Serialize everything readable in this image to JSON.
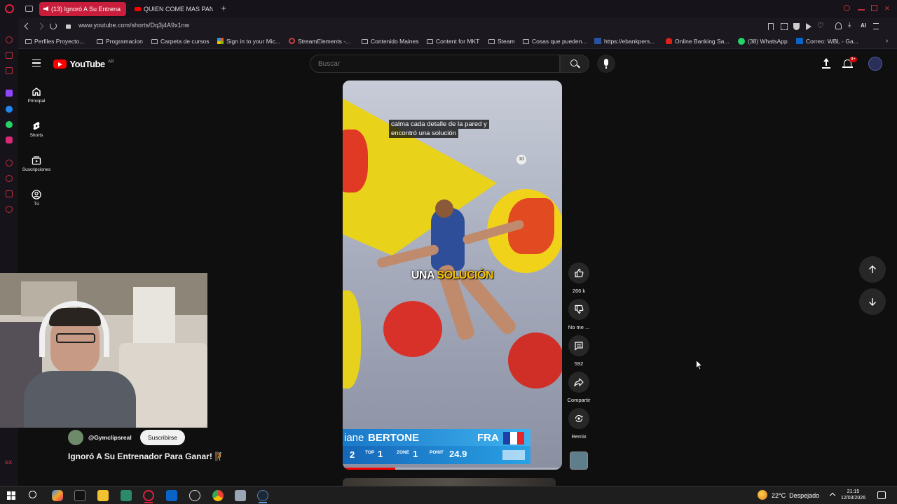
{
  "browser": {
    "tabs": [
      {
        "label": "(13) Ignoró A Su Entrena",
        "active": true
      },
      {
        "label": "QUIEN COME MAS PANCHO",
        "active": false
      }
    ],
    "url": "www.youtube.com/shorts/Dq3j4A9x1nw",
    "ai_label": "AI",
    "bookmarks": [
      "Perfiles Proyecto...",
      "Programacion",
      "Carpeta de cursos",
      "Sign in to your Mic...",
      "StreamElements -...",
      "Contenido Maines",
      "Content for MKT",
      "Steam",
      "Cosas que pueden...",
      "https://ebankpers...",
      "Online Banking Sa...",
      "(38) WhatsApp",
      "Correo: WBL - Ga..."
    ],
    "bookmark_badge": "38"
  },
  "youtube": {
    "logo_text": "YouTube",
    "logo_region": "AR",
    "search": {
      "placeholder": "Buscar"
    },
    "notif_badge": "9+",
    "nav": [
      {
        "label": "Principal",
        "icon": "home-icon"
      },
      {
        "label": "Shorts",
        "icon": "shorts-icon"
      },
      {
        "label": "Suscripciones",
        "icon": "subscriptions-icon"
      },
      {
        "label": "Tú",
        "icon": "you-icon"
      }
    ],
    "video": {
      "subtitle_line1": "calma cada detalle de la pared y",
      "subtitle_line2": "encontró una solución",
      "caption_white": "UNA",
      "caption_yellow": "SOLUCIÓN",
      "hold_number": "10",
      "scoreboard": {
        "name_prefix": "iane",
        "name": "BERTONE",
        "country": "FRA",
        "rank": "2",
        "top_label": "TOP",
        "top_value": "1",
        "zone_label": "ZONE",
        "zone_value": "1",
        "point_label": "POINT",
        "point_value": "24.9"
      },
      "progress": 0.24
    },
    "actions": {
      "like_count": "266 k",
      "dislike_label": "No me ...",
      "comments_count": "592",
      "share_label": "Compartir",
      "remix_label": "Remix"
    },
    "channel": {
      "handle": "@Gymclipsreal",
      "subscribe_label": "Suscribirse",
      "title": "Ignoró A Su Entrenador Para Ganar! 🧗"
    }
  },
  "taskbar": {
    "weather": "22°C  Despejado",
    "time": "21:15",
    "date": "12/03/2026"
  },
  "colors": {
    "yt_red": "#ff0000",
    "accent_yellow": "#f5c400",
    "scoreboard_blue": "#1f8ed6",
    "browser_red": "#c0303a"
  }
}
